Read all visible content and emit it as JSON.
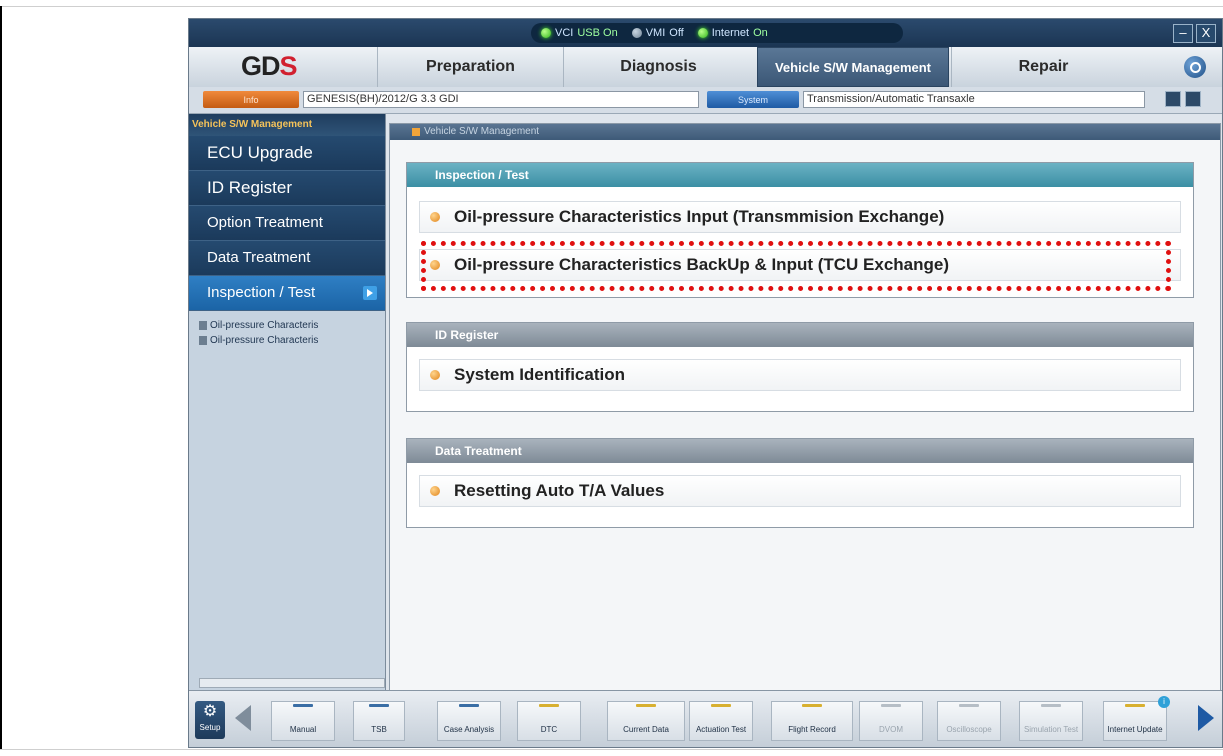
{
  "status": {
    "items": [
      {
        "label": "VCI",
        "value": "USB On",
        "state": "on"
      },
      {
        "label": "VMI",
        "value": "Off",
        "state": "off"
      },
      {
        "label": "Internet",
        "value": "On",
        "state": "on"
      }
    ],
    "window_minimize": "–",
    "window_close": "X"
  },
  "nav": {
    "logo_main": "GD",
    "logo_accent": "S",
    "tabs": [
      "Preparation",
      "Diagnosis",
      "Vehicle S/W Management",
      "Repair"
    ],
    "active_tab": "Vehicle S/W Management"
  },
  "inforow": {
    "info_button": "Info",
    "vehicle": "GENESIS(BH)/2012/G 3.3 GDI",
    "system_button": "System",
    "system_value": "Transmission/Automatic Transaxle"
  },
  "sidebar": {
    "header": "Vehicle S/W Management",
    "items": [
      "ECU Upgrade",
      "ID Register",
      "Option Treatment",
      "Data Treatment",
      "Inspection / Test"
    ],
    "active": "Inspection / Test",
    "tree": [
      "Oil-pressure Characteris",
      "Oil-pressure Characteris"
    ]
  },
  "main": {
    "title": "Vehicle S/W Management",
    "sections": [
      {
        "header": "Inspection / Test",
        "items": [
          "Oil-pressure Characteristics Input (Transmmision Exchange)",
          "Oil-pressure Characteristics BackUp & Input (TCU Exchange)"
        ],
        "highlighted_item": "Oil-pressure Characteristics BackUp & Input (TCU Exchange)"
      },
      {
        "header": "ID Register",
        "items": [
          "System Identification"
        ]
      },
      {
        "header": "Data Treatment",
        "items": [
          "Resetting Auto T/A Values"
        ]
      }
    ]
  },
  "toolbar": {
    "setup": "Setup",
    "tools": [
      {
        "label": "Manual",
        "enabled": true
      },
      {
        "label": "TSB",
        "enabled": true
      },
      {
        "label": "Case Analysis",
        "enabled": true
      },
      {
        "label": "DTC",
        "enabled": true
      },
      {
        "label": "Current Data",
        "enabled": true
      },
      {
        "label": "Actuation Test",
        "enabled": true
      },
      {
        "label": "Flight Record",
        "enabled": true
      },
      {
        "label": "DVOM",
        "enabled": false
      },
      {
        "label": "Oscilloscope",
        "enabled": false
      },
      {
        "label": "Simulation Test",
        "enabled": false
      },
      {
        "label": "Internet Update",
        "enabled": true
      }
    ]
  },
  "colors": {
    "accent_blue": "#1b3a5b",
    "highlight_red": "#e01010",
    "bullet_orange": "#e0841a",
    "logo_red": "#d1202f"
  }
}
